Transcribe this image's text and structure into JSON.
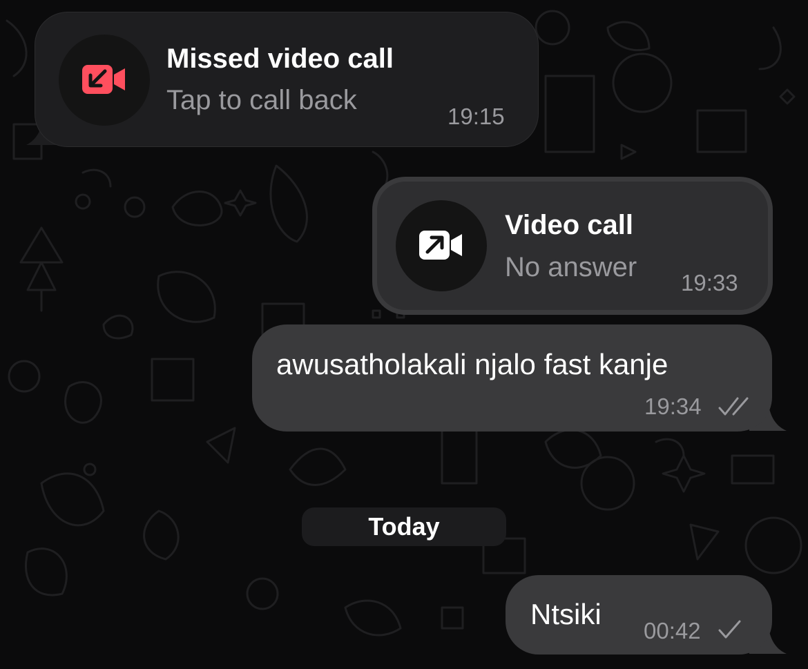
{
  "messages": {
    "missed_call": {
      "title": "Missed video call",
      "subtitle": "Tap to call back",
      "time": "19:15",
      "icon": "missed-video-call-icon",
      "icon_color": "#ff4f5e"
    },
    "video_call": {
      "title": "Video call",
      "subtitle": "No answer",
      "time": "19:33",
      "icon": "outgoing-video-call-icon"
    },
    "text_message_1": {
      "text": "awusatholakali njalo fast kanje",
      "time": "19:34",
      "status": "double-check-icon"
    },
    "date_separator": {
      "label": "Today"
    },
    "text_message_2": {
      "text": "Ntsiki",
      "time": "00:42",
      "status": "single-check-icon"
    }
  },
  "colors": {
    "background": "#0b0b0c",
    "incoming_bubble": "#1e1e20",
    "outgoing_bubble": "#3a3a3c",
    "secondary_text": "#9a9a9e"
  }
}
